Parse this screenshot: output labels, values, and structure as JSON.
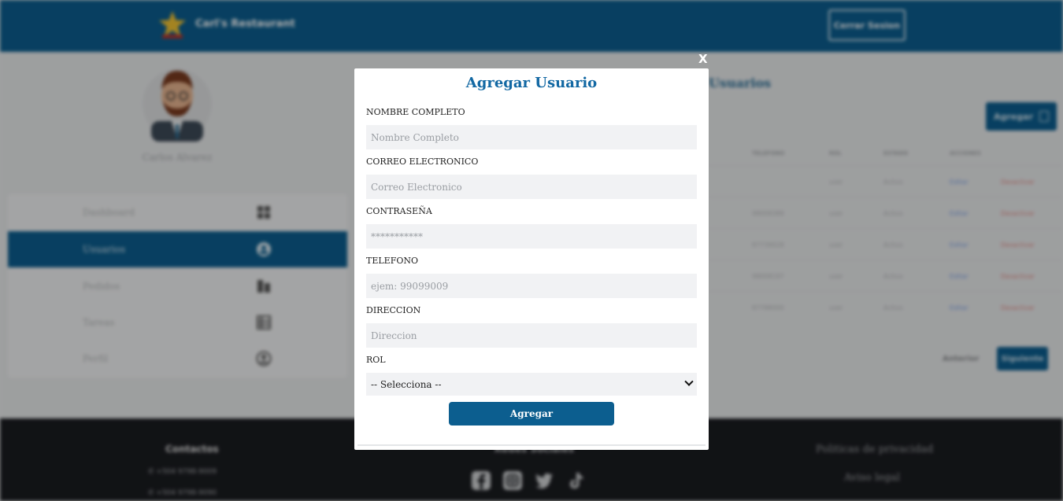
{
  "header": {
    "brand": "Carl's Restaurant",
    "logout_label": "Cerrar Sesion"
  },
  "profile": {
    "name": "Carlos Alvarez"
  },
  "sidebar": {
    "items": [
      {
        "label": "Dashboard",
        "icon": "dashboard-icon",
        "active": false
      },
      {
        "label": "Usuarios",
        "icon": "users-icon",
        "active": true
      },
      {
        "label": "Pedidos",
        "icon": "orders-icon",
        "active": false
      },
      {
        "label": "Tareas",
        "icon": "tasks-icon",
        "active": false
      },
      {
        "label": "Perfil",
        "icon": "profile-icon",
        "active": false
      }
    ]
  },
  "users_panel": {
    "title": "Usuarios",
    "add_label": "Agregar",
    "columns": [
      "TELEFONO",
      "ROL",
      "ESTADO",
      "ACCIONES"
    ],
    "rows": [
      {
        "telefono": "",
        "rol": "user",
        "estado": "Activo",
        "edit": "Editar",
        "off": "Desactivar"
      },
      {
        "telefono": "98008388",
        "rol": "user",
        "estado": "Activo",
        "edit": "Editar",
        "off": "Desactivar"
      },
      {
        "telefono": "87739028",
        "rol": "user",
        "estado": "Activo",
        "edit": "Editar",
        "off": "Desactivar"
      },
      {
        "telefono": "98008197",
        "rol": "user",
        "estado": "Activo",
        "edit": "Editar",
        "off": "Desactivar"
      },
      {
        "telefono": "87788000",
        "rol": "user",
        "estado": "Activo",
        "edit": "Editar",
        "off": "Desactivar"
      }
    ],
    "prev_label": "Anterior",
    "next_label": "Siguiente"
  },
  "footer": {
    "contact_title": "Contactos",
    "phones": [
      "+504 9798-9009",
      "+504 9798-9090"
    ],
    "social_title": "Redes Sociales",
    "social_icons": [
      "facebook-icon",
      "instagram-icon",
      "twitter-icon",
      "tiktok-icon"
    ],
    "privacy": "Politicas de privacidad",
    "legal": "Aviso legal"
  },
  "modal": {
    "close_label": "X",
    "title": "Agregar Usuario",
    "fields": {
      "nombre": {
        "label": "NOMBRE COMPLETO",
        "placeholder": "Nombre Completo",
        "value": ""
      },
      "correo": {
        "label": "CORREO ELECTRONICO",
        "placeholder": "Correo Electronico",
        "value": ""
      },
      "password": {
        "label": "CONTRASEÑA",
        "placeholder": "***********",
        "value": ""
      },
      "telefono": {
        "label": "TELEFONO",
        "placeholder": "ejem: 99099009",
        "value": ""
      },
      "direccion": {
        "label": "DIRECCION",
        "placeholder": "Direccion",
        "value": ""
      },
      "rol": {
        "label": "ROL",
        "selected": "-- Selecciona --"
      }
    },
    "submit_label": "Agregar"
  },
  "colors": {
    "primary": "#0c5e8f",
    "title": "#1268a3",
    "input_bg": "#f1f2f4"
  }
}
